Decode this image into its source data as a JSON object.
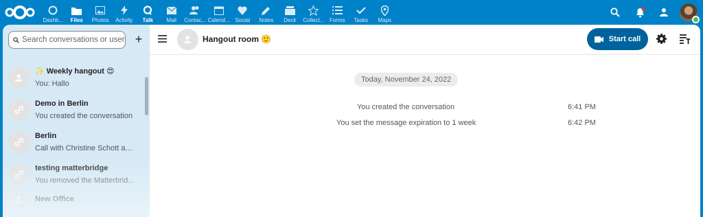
{
  "topbar": {
    "apps": [
      {
        "label": "Dashb...",
        "icon": "dashboard-icon",
        "active": false
      },
      {
        "label": "Files",
        "icon": "folder-icon",
        "active": true
      },
      {
        "label": "Photos",
        "icon": "image-icon",
        "active": false
      },
      {
        "label": "Activity",
        "icon": "lightning-icon",
        "active": false
      },
      {
        "label": "Talk",
        "icon": "talk-icon",
        "active": true
      },
      {
        "label": "Mail",
        "icon": "mail-icon",
        "active": false
      },
      {
        "label": "Contac...",
        "icon": "contacts-icon",
        "active": false
      },
      {
        "label": "Calend...",
        "icon": "calendar-icon",
        "active": false
      },
      {
        "label": "Social",
        "icon": "heart-icon",
        "active": false
      },
      {
        "label": "Notes",
        "icon": "pencil-icon",
        "active": false
      },
      {
        "label": "Deck",
        "icon": "deck-icon",
        "active": false
      },
      {
        "label": "Collect...",
        "icon": "star-icon",
        "active": false
      },
      {
        "label": "Forms",
        "icon": "forms-icon",
        "active": false
      },
      {
        "label": "Tasks",
        "icon": "check-icon",
        "active": false
      },
      {
        "label": "Maps",
        "icon": "map-pin-icon",
        "active": false
      }
    ]
  },
  "sidebar": {
    "search_placeholder": "Search conversations or users",
    "add_label": "+",
    "conversations": [
      {
        "name": "✨ Weekly hangout 😍",
        "sub": "You: Hallo",
        "icon": "user-icon"
      },
      {
        "name": "Demo in Berlin",
        "sub": "You created the conversation",
        "icon": "link-icon"
      },
      {
        "name": "Berlin",
        "sub": "Call with Christine Schott an...",
        "icon": "link-icon"
      },
      {
        "name": "testing matterbridge",
        "sub": "You removed the Matterbrid...",
        "icon": "link-icon"
      },
      {
        "name": "New Office",
        "sub": "",
        "icon": "user-icon"
      }
    ]
  },
  "main": {
    "room_title": "Hangout room 🙂",
    "start_call_label": "Start call",
    "date": "Today, November 24, 2022",
    "messages": [
      {
        "text": "You created the conversation",
        "time": "6:41 PM"
      },
      {
        "text": "You set the message expiration to 1 week",
        "time": "6:42 PM"
      }
    ]
  },
  "colors": {
    "brand": "#0082c9",
    "call_button": "#00639d",
    "sidebar_bg": "#d6e9f5",
    "status_online": "#46ba61"
  }
}
